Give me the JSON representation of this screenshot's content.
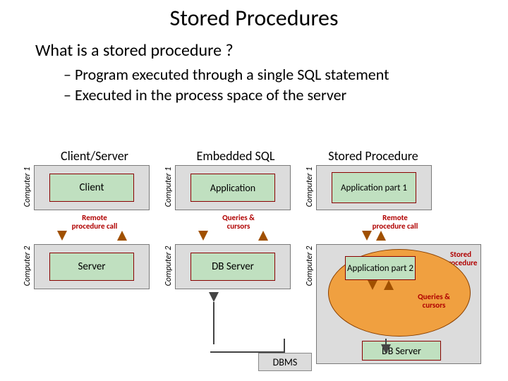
{
  "title": "Stored Procedures",
  "subtitle": "What is a stored procedure ?",
  "bullets": [
    "Program executed through a single SQL statement",
    "Executed in the process space of the server"
  ],
  "computer1_label": "Computer 1",
  "computer2_label": "Computer 2",
  "columns": {
    "client_server": {
      "header": "Client/Server",
      "top": "Client",
      "mid": "Remote procedure call",
      "bot": "Server"
    },
    "embedded": {
      "header": "Embedded SQL",
      "top": "Application",
      "mid": "Queries & cursors",
      "bot": "DB Server"
    },
    "stored_proc": {
      "header": "Stored Procedure",
      "top": "Application part 1",
      "mid": "Remote procedure call",
      "part2": "Application part 2",
      "qc": "Queries & cursors",
      "dbserver": "DB Server",
      "sp_label": "Stored procedure"
    }
  },
  "dbms": "DBMS"
}
